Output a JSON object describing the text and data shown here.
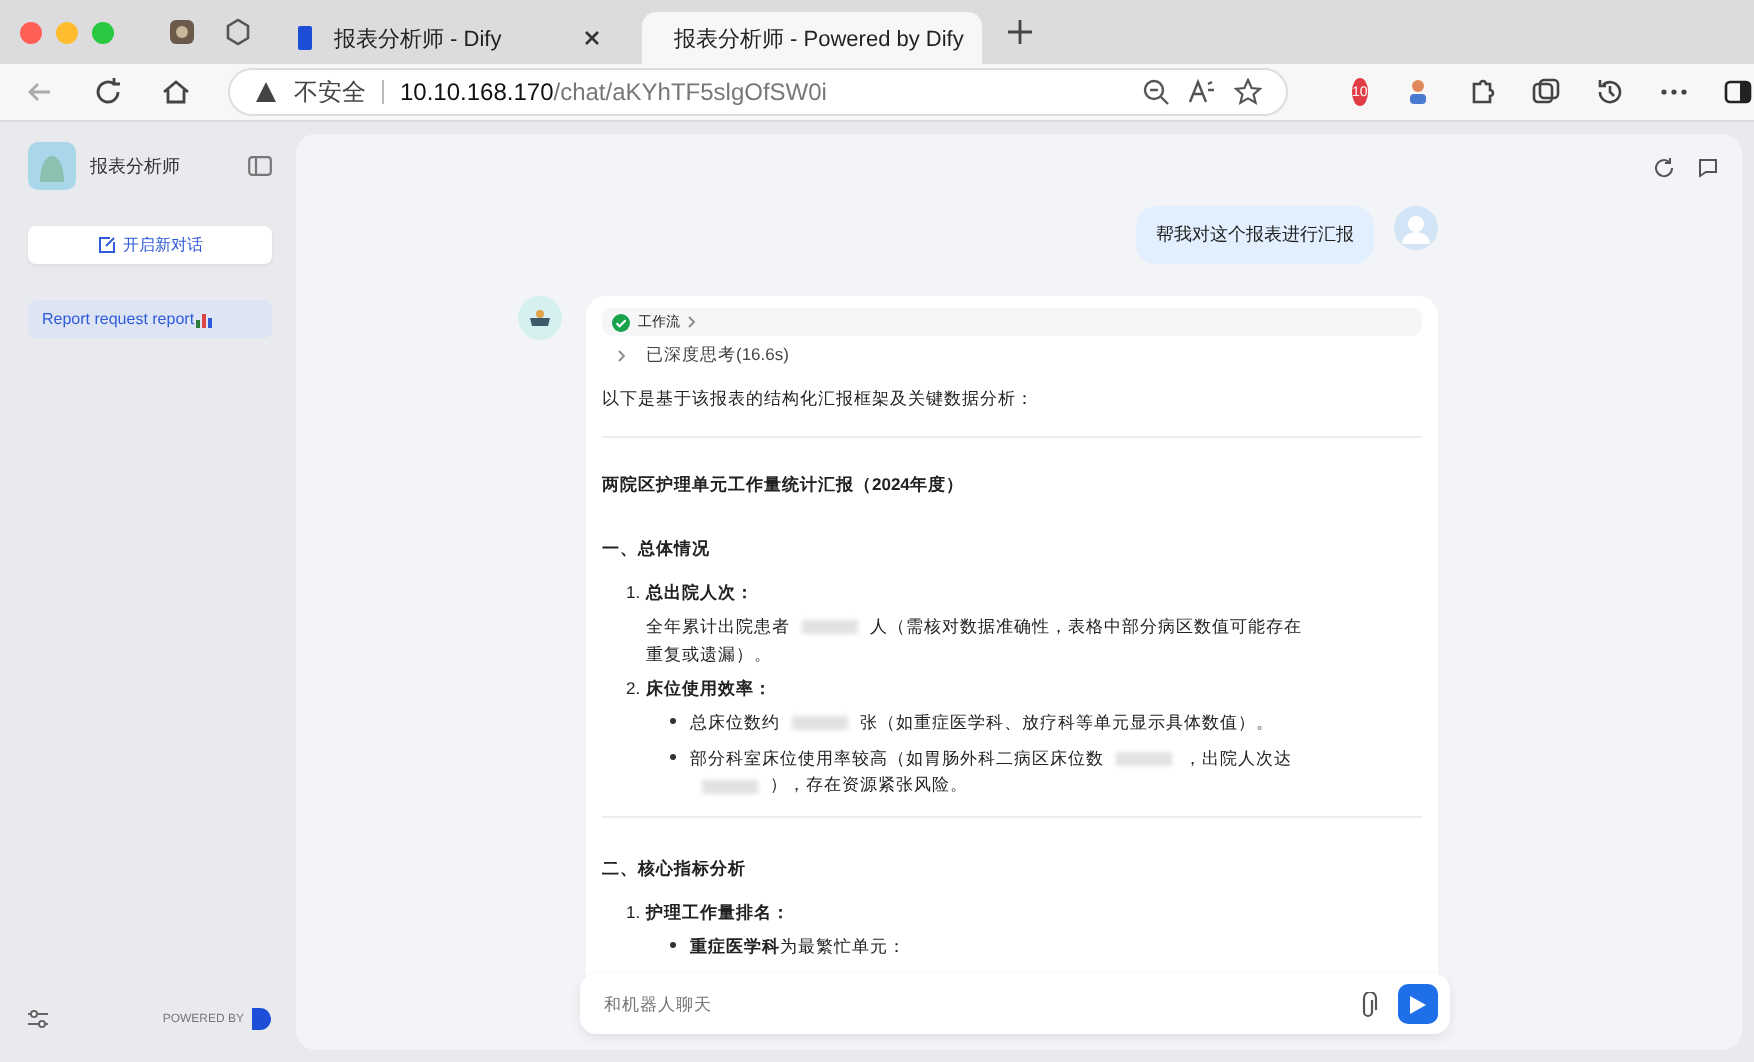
{
  "browser": {
    "tabs": [
      {
        "title": "报表分析师 - Dify",
        "selected": false
      },
      {
        "title": "报表分析师 - Powered by Dify",
        "selected": true
      }
    ],
    "address": {
      "security": "不安全",
      "host": "10.10.168.170",
      "path": "/chat/aKYhTF5slgOfSW0i"
    },
    "extension_badge": "10"
  },
  "sidebar": {
    "app_name": "报表分析师",
    "new_chat": "开启新对话",
    "conversations": [
      {
        "title": "Report request report",
        "selected": true
      }
    ],
    "powered_by": "POWERED BY"
  },
  "chat": {
    "user_message": "帮我对这个报表进行汇报",
    "workflow": {
      "label": "工作流",
      "succeeded": true
    },
    "thinking": "已深度思考(16.6s)",
    "intro": "以下是基于该报表的结构化汇报框架及关键数据分析：",
    "report_title": "两院区护理单元工作量统计汇报（2024年度）",
    "sections": [
      {
        "heading": "一、总体情况",
        "items": [
          {
            "marker": "1.",
            "title": "总出院人次：",
            "text_parts": [
              "全年累计出院患者",
              "人（需核对数据准确性，表格中部分病区数值可能存在重复或遗漏）。"
            ]
          },
          {
            "marker": "2.",
            "title": "床位使用效率：",
            "bullets": [
              [
                "总床位数约",
                "张（如重症医学科、放疗科等单元显示具体数值）。"
              ],
              [
                "部分科室床位使用率较高（如胃肠外科二病区床位数",
                "，出院人次达",
                "），存在资源紧张风险。"
              ]
            ]
          }
        ]
      },
      {
        "heading": "二、核心指标分析",
        "items": [
          {
            "marker": "1.",
            "title": "护理工作量排名：",
            "bullets": [
              [
                "**重症医学科**为最繁忙单元："
              ]
            ]
          }
        ]
      }
    ],
    "input_placeholder": "和机器人聊天"
  }
}
